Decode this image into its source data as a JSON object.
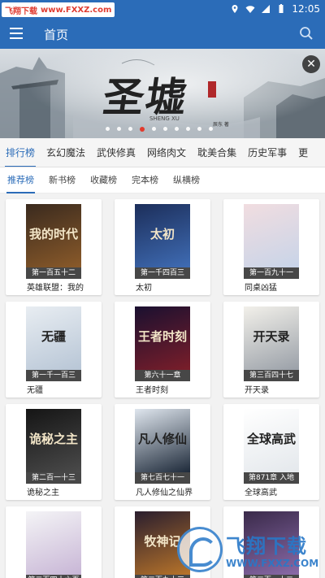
{
  "status_bar": {
    "watermark_brand": "飞翔下载",
    "watermark_url": "www.FXXZ.com",
    "time": "12:05"
  },
  "app_bar": {
    "title": "首页",
    "menu_icon": "menu-icon",
    "search_icon": "search-icon"
  },
  "banner": {
    "title": "圣墟",
    "subtitle": "SHENG XU",
    "side_text": "辰东 著",
    "slide_count": 10,
    "active_slide": 3
  },
  "category_tabs": [
    {
      "label": "排行榜",
      "active": true
    },
    {
      "label": "玄幻魔法",
      "active": false
    },
    {
      "label": "武侠修真",
      "active": false
    },
    {
      "label": "网络肉文",
      "active": false
    },
    {
      "label": "耽美合集",
      "active": false
    },
    {
      "label": "历史军事",
      "active": false
    },
    {
      "label": "更",
      "active": false
    }
  ],
  "sub_tabs": [
    {
      "label": "推荐榜",
      "active": true
    },
    {
      "label": "新书榜",
      "active": false
    },
    {
      "label": "收藏榜",
      "active": false
    },
    {
      "label": "完本榜",
      "active": false
    },
    {
      "label": "纵横榜",
      "active": false
    }
  ],
  "books": [
    {
      "title": "英雄联盟：我的",
      "chapter": "第一百五十二",
      "cover_text": "我的时代",
      "colors": [
        "#3a2a1e",
        "#8a5a2a"
      ]
    },
    {
      "title": "太初",
      "chapter": "第一千四百三",
      "cover_text": "太初",
      "colors": [
        "#1c2e5a",
        "#3f6cb4"
      ]
    },
    {
      "title": "同桌凶猛",
      "chapter": "第一百九十一",
      "cover_text": "",
      "colors": [
        "#f1dde0",
        "#c8d4e8"
      ]
    },
    {
      "title": "无疆",
      "chapter": "第一千一百三",
      "cover_text": "无疆",
      "colors": [
        "#e8edf2",
        "#b8c6d6"
      ]
    },
    {
      "title": "王者时刻",
      "chapter": "第六十一章",
      "cover_text": "王者时刻",
      "colors": [
        "#1a1030",
        "#7a1e2a"
      ]
    },
    {
      "title": "开天录",
      "chapter": "第三百四十七",
      "cover_text": "开天录",
      "colors": [
        "#f2f0ea",
        "#9aa0a8"
      ]
    },
    {
      "title": "诡秘之主",
      "chapter": "第二百一十三",
      "cover_text": "诡秘之主",
      "colors": [
        "#151515",
        "#4a4a4a"
      ]
    },
    {
      "title": "凡人修仙之仙界",
      "chapter": "第七百七十一",
      "cover_text": "凡人修仙",
      "colors": [
        "#dfe6ee",
        "#1e2a3a"
      ]
    },
    {
      "title": "全球高武",
      "chapter": "第871章 入地",
      "cover_text": "全球高武",
      "colors": [
        "#ffffff",
        "#e4e8ec"
      ]
    },
    {
      "title": "",
      "chapter": "第二百四十六页",
      "cover_text": "",
      "colors": [
        "#f4f4f6",
        "#c8b6d6"
      ]
    },
    {
      "title": "",
      "chapter": "第二百九十三",
      "cover_text": "牧神记",
      "colors": [
        "#2a1e2e",
        "#b8742a"
      ]
    },
    {
      "title": "",
      "chapter": "第二百一十二",
      "cover_text": "",
      "colors": [
        "#3a2a4a",
        "#8a6aa8"
      ]
    }
  ],
  "bottom_watermark": {
    "brand": "飞翔下载",
    "url": "WWW.FXXZ.COM"
  },
  "colors": {
    "primary": "#2b6cb8",
    "active_dot": "#e23a2d"
  }
}
